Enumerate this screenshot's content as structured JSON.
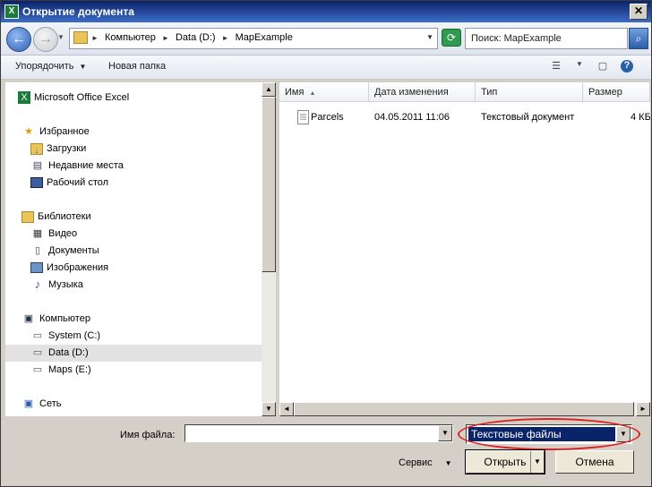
{
  "window": {
    "title": "Открытие документа"
  },
  "nav": {
    "breadcrumbs": [
      "Компьютер",
      "Data (D:)",
      "MapExample"
    ],
    "search_placeholder": "Поиск: MapExample"
  },
  "toolbar": {
    "organize_label": "Упорядочить",
    "new_folder_label": "Новая папка"
  },
  "sidebar": {
    "items": [
      {
        "label": "Microsoft Office Excel",
        "icon": "excel-icon"
      },
      {
        "label": "Избранное",
        "icon": "star-icon"
      },
      {
        "label": "Загрузки",
        "icon": "downloads-folder-icon"
      },
      {
        "label": "Недавние места",
        "icon": "recent-places-icon"
      },
      {
        "label": "Рабочий стол",
        "icon": "desktop-icon"
      },
      {
        "label": "Библиотеки",
        "icon": "libraries-icon"
      },
      {
        "label": "Видео",
        "icon": "video-icon"
      },
      {
        "label": "Документы",
        "icon": "documents-icon"
      },
      {
        "label": "Изображения",
        "icon": "pictures-icon"
      },
      {
        "label": "Музыка",
        "icon": "music-icon"
      },
      {
        "label": "Компьютер",
        "icon": "computer-icon"
      },
      {
        "label": "System (C:)",
        "icon": "system-drive-icon"
      },
      {
        "label": "Data (D:)",
        "icon": "drive-icon",
        "selected": true
      },
      {
        "label": "Maps (E:)",
        "icon": "drive-icon"
      },
      {
        "label": "Сеть",
        "icon": "network-icon"
      }
    ]
  },
  "columns": [
    "Имя",
    "Дата изменения",
    "Тип",
    "Размер"
  ],
  "files": [
    {
      "name": "Parcels",
      "modified": "04.05.2011 11:06",
      "type": "Текстовый документ",
      "size": "4 КБ"
    }
  ],
  "bottom": {
    "filename_label": "Имя файла:",
    "filename_value": "",
    "filetype_selected": "Текстовые файлы",
    "service_label": "Сервис",
    "open_label": "Открыть",
    "cancel_label": "Отмена"
  },
  "colors": {
    "title_bar": "#0a246a",
    "selection": "#0a246a",
    "highlight_ellipse": "#e02020"
  }
}
